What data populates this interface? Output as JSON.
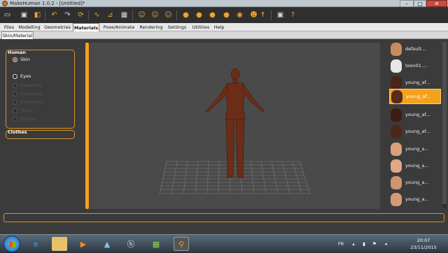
{
  "window": {
    "title": "MakeHuman 1.0.2 - [Untitled]*"
  },
  "window_controls": {
    "minimize": "–",
    "maximize": "□",
    "close": "✕"
  },
  "toolbar": {
    "icons": [
      "folder-icon",
      "save-icon",
      "export-icon",
      "undo-icon",
      "redo-icon",
      "reset-icon",
      "smooth-icon",
      "wireframe-icon",
      "checker-icon",
      "face-front-icon",
      "face-left-icon",
      "face-right-icon",
      "head-front-icon",
      "head-back-icon",
      "head-left-icon",
      "head-right-icon",
      "eye-icon",
      "pose-icon",
      "screenshot-icon",
      "help-icon"
    ]
  },
  "menu": {
    "tabs": [
      "Files",
      "Modelling",
      "Geometries",
      "Materials",
      "Pose/Animate",
      "Rendering",
      "Settings",
      "Utilities",
      "Help"
    ],
    "active": "Materials"
  },
  "subtabs": {
    "tabs": [
      "Skin/Material"
    ]
  },
  "left": {
    "human_title": "Human",
    "options": [
      {
        "label": "Skin",
        "selected": true,
        "enabled": true
      },
      {
        "label": "Eyes",
        "selected": false,
        "enabled": true
      },
      {
        "label": "Eyebrows",
        "selected": false,
        "enabled": false
      },
      {
        "label": "Eyebrows",
        "selected": false,
        "enabled": false
      },
      {
        "label": "Eyelashes",
        "selected": false,
        "enabled": false
      },
      {
        "label": "Teeth",
        "selected": false,
        "enabled": false
      },
      {
        "label": "Tongue",
        "selected": false,
        "enabled": false
      }
    ],
    "clothes_title": "Clothes"
  },
  "materials": [
    {
      "label": "default...",
      "color": "#c98a5c",
      "selected": false
    },
    {
      "label": "toon01....",
      "color": "#e6e6e6",
      "selected": false
    },
    {
      "label": "young_af...",
      "color": "#4a2418",
      "selected": false
    },
    {
      "label": "young_af...",
      "color": "#5a2a1a",
      "selected": true
    },
    {
      "label": "young_af...",
      "color": "#3d1d13",
      "selected": false
    },
    {
      "label": "young_af...",
      "color": "#4d2618",
      "selected": false
    },
    {
      "label": "young_a...",
      "color": "#d9a07c",
      "selected": false
    },
    {
      "label": "young_a...",
      "color": "#e0a888",
      "selected": false
    },
    {
      "label": "young_a...",
      "color": "#cf9470",
      "selected": false
    },
    {
      "label": "young_a...",
      "color": "#d69a78",
      "selected": false
    }
  ],
  "taskbar": {
    "lang": "FR",
    "time": "20:07",
    "date": "23/11/2015"
  },
  "colors": {
    "accent": "#f3a21e",
    "skin": "#6b2c18"
  }
}
